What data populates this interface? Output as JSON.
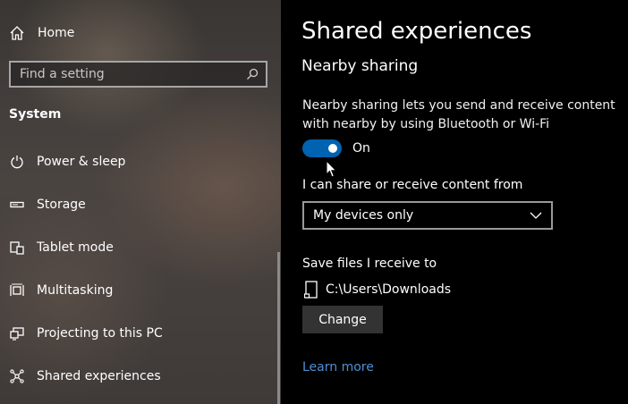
{
  "sidebar": {
    "home_label": "Home",
    "search_placeholder": "Find a setting",
    "section_title": "System",
    "items": [
      {
        "label": "Power & sleep",
        "icon": "power-icon"
      },
      {
        "label": "Storage",
        "icon": "storage-icon"
      },
      {
        "label": "Tablet mode",
        "icon": "tablet-mode-icon"
      },
      {
        "label": "Multitasking",
        "icon": "multitasking-icon"
      },
      {
        "label": "Projecting to this PC",
        "icon": "projecting-icon"
      },
      {
        "label": "Shared experiences",
        "icon": "shared-experiences-icon"
      }
    ]
  },
  "main": {
    "title": "Shared experiences",
    "subtitle": "Nearby sharing",
    "description": "Nearby sharing lets you send and receive content with nearby by using Bluetooth or Wi-Fi",
    "toggle": {
      "state": "on",
      "label": "On"
    },
    "share_from_label": "I can share or receive content from",
    "share_from_value": "My devices only",
    "save_label": "Save files I receive to",
    "save_path": "C:\\Users\\Downloads",
    "change_label": "Change",
    "learn_more": "Learn more"
  },
  "colors": {
    "accent": "#0063b1",
    "link": "#4f8fd4",
    "background": "#000000"
  }
}
